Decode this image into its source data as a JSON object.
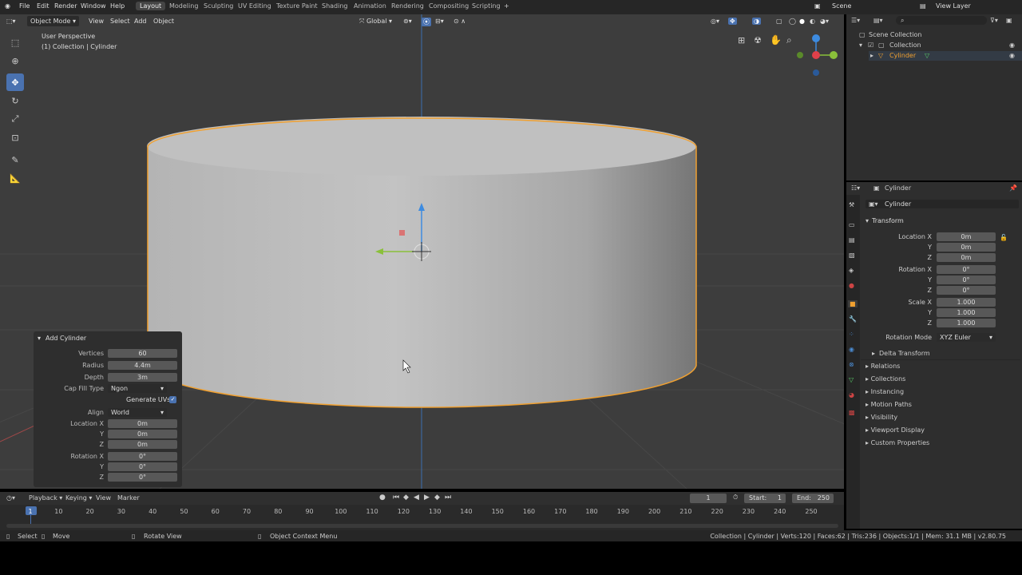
{
  "colors": {
    "accent": "#4a72b0",
    "selection": "#f0a030",
    "viewport_bg": "#3d3d3d",
    "panel_bg": "#2e2e2e",
    "field": "#585858"
  },
  "top_menu": [
    "File",
    "Edit",
    "Render",
    "Window",
    "Help"
  ],
  "workspaces": [
    "Layout",
    "Modeling",
    "Sculpting",
    "UV Editing",
    "Texture Paint",
    "Shading",
    "Animation",
    "Rendering",
    "Compositing",
    "Scripting"
  ],
  "active_workspace": "Layout",
  "scene": "Scene",
  "view_layer": "View Layer",
  "viewport": {
    "mode": "Object Mode",
    "menus": [
      "View",
      "Select",
      "Add",
      "Object"
    ],
    "orientation": "Global",
    "perspective": "User Perspective",
    "collection_label": "(1) Collection | Cylinder"
  },
  "redo_panel": {
    "title": "Add Cylinder",
    "vertices_label": "Vertices",
    "vertices": "60",
    "radius_label": "Radius",
    "radius": "4.4m",
    "depth_label": "Depth",
    "depth": "3m",
    "cap_label": "Cap Fill Type",
    "cap": "Ngon",
    "uvs_label": "Generate UVs",
    "align_label": "Align",
    "align": "World",
    "loc_x_label": "Location X",
    "loc_x": "0m",
    "loc_y_label": "Y",
    "loc_y": "0m",
    "loc_z_label": "Z",
    "loc_z": "0m",
    "rot_x_label": "Rotation X",
    "rot_x": "0°",
    "rot_y_label": "Y",
    "rot_y": "0°",
    "rot_z_label": "Z",
    "rot_z": "0°"
  },
  "timeline": {
    "menus": [
      "Playback",
      "Keying",
      "View",
      "Marker"
    ],
    "current_frame": "1",
    "start_label": "Start:",
    "start": "1",
    "end_label": "End:",
    "end": "250",
    "ticks": [
      "1",
      "10",
      "20",
      "30",
      "40",
      "50",
      "60",
      "70",
      "80",
      "90",
      "100",
      "110",
      "120",
      "130",
      "140",
      "150",
      "160",
      "170",
      "180",
      "190",
      "200",
      "210",
      "220",
      "230",
      "240",
      "250"
    ]
  },
  "status": {
    "select": "Select",
    "move": "Move",
    "rotate": "Rotate View",
    "context": "Object Context Menu",
    "info": "Collection | Cylinder | Verts:120 | Faces:62 | Tris:236 | Objects:1/1 | Mem: 31.1 MB | v2.80.75"
  },
  "outliner": {
    "scene_collection": "Scene Collection",
    "collection": "Collection",
    "object": "Cylinder"
  },
  "properties": {
    "header": "Cylinder",
    "object_name": "Cylinder",
    "transform": "Transform",
    "loc_x_label": "Location X",
    "loc_x": "0m",
    "loc_y_label": "Y",
    "loc_y": "0m",
    "loc_z_label": "Z",
    "loc_z": "0m",
    "rot_x_label": "Rotation X",
    "rot_x": "0°",
    "rot_y_label": "Y",
    "rot_y": "0°",
    "rot_z_label": "Z",
    "rot_z": "0°",
    "scale_x_label": "Scale X",
    "scale_x": "1.000",
    "scale_y_label": "Y",
    "scale_y": "1.000",
    "scale_z_label": "Z",
    "scale_z": "1.000",
    "rot_mode_label": "Rotation Mode",
    "rot_mode": "XYZ Euler",
    "delta": "Delta Transform",
    "panels": [
      "Relations",
      "Collections",
      "Instancing",
      "Motion Paths",
      "Visibility",
      "Viewport Display",
      "Custom Properties"
    ]
  }
}
